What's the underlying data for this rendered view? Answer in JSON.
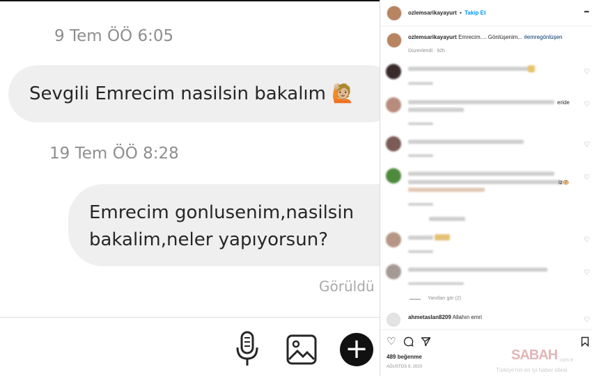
{
  "chat": {
    "ts1": "9 Tem ÖÖ 6:05",
    "msg1": "Sevgili Emrecim nasilsin bakalım 🙋🏼",
    "ts2": "19 Tem ÖÖ 8:28",
    "msg2_line1": "Emrecim gonlusenim,nasilsin",
    "msg2_line2": "bakalim,neler yapıyorsun?",
    "seen": "Görüldü",
    "icons": [
      "microphone-icon",
      "image-icon",
      "plus-icon"
    ]
  },
  "post": {
    "username": "ozlemsarikayayurt",
    "dot": "•",
    "follow": "Takip Et",
    "more": "•••",
    "caption_user": "ozlemsarikayayurt",
    "caption_text": "Emrecim.... Gönlüşenim...",
    "caption_tag": "#emregönlüşen",
    "edited": "Düzenlendi · 92h",
    "comment_frag_1": "eride",
    "comment_frag_2": "iz🐵",
    "replies": "Yanıtları gör (2)",
    "last_comment_user": "ahmetaslan8209",
    "last_comment_text": "Allahın emri",
    "likes": "489 beğenme",
    "date": "AĞUSTOS 9, 2020"
  },
  "watermark": {
    "brand": "SABAH",
    "tld": ".com.tr",
    "slogan": "Türkiye'nin en iyi haber sitesi"
  },
  "colors": {
    "link": "#0095f6",
    "bubble": "#efefef",
    "muted": "#8e8e8e"
  }
}
